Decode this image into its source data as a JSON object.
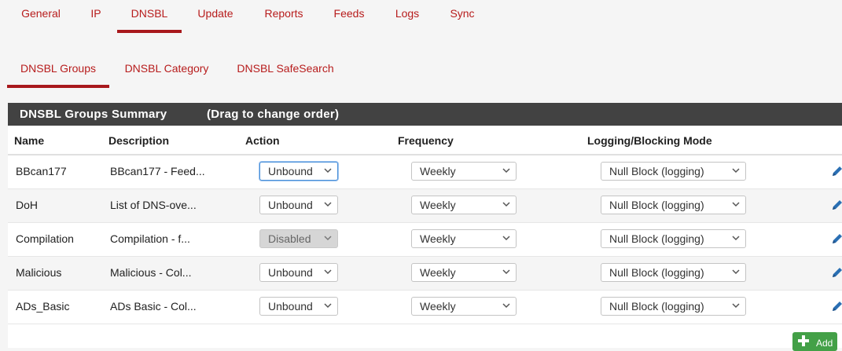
{
  "top_tabs": [
    {
      "label": "General",
      "active": false
    },
    {
      "label": "IP",
      "active": false
    },
    {
      "label": "DNSBL",
      "active": true
    },
    {
      "label": "Update",
      "active": false
    },
    {
      "label": "Reports",
      "active": false
    },
    {
      "label": "Feeds",
      "active": false
    },
    {
      "label": "Logs",
      "active": false
    },
    {
      "label": "Sync",
      "active": false
    }
  ],
  "sub_tabs": [
    {
      "label": "DNSBL Groups",
      "active": true
    },
    {
      "label": "DNSBL Category",
      "active": false
    },
    {
      "label": "DNSBL SafeSearch",
      "active": false
    }
  ],
  "panel": {
    "title": "DNSBL Groups Summary",
    "subtitle": "(Drag to change order)"
  },
  "columns": {
    "name": "Name",
    "description": "Description",
    "action": "Action",
    "frequency": "Frequency",
    "mode": "Logging/Blocking Mode"
  },
  "rows": [
    {
      "name": "BBcan177",
      "description": "BBcan177 - Feed...",
      "action": "Unbound",
      "frequency": "Weekly",
      "mode": "Null Block (logging)"
    },
    {
      "name": "DoH",
      "description": "List of DNS-ove...",
      "action": "Unbound",
      "frequency": "Weekly",
      "mode": "Null Block (logging)"
    },
    {
      "name": "Compilation",
      "description": "Compilation - f...",
      "action": "Disabled",
      "frequency": "Weekly",
      "mode": "Null Block (logging)"
    },
    {
      "name": "Malicious",
      "description": "Malicious - Col...",
      "action": "Unbound",
      "frequency": "Weekly",
      "mode": "Null Block (logging)"
    },
    {
      "name": "ADs_Basic",
      "description": "ADs Basic - Col...",
      "action": "Unbound",
      "frequency": "Weekly",
      "mode": "Null Block (logging)"
    }
  ],
  "add_button": {
    "label": "Add"
  },
  "colors": {
    "accent": "#b71c1c",
    "header_bg": "#424242",
    "add_bg": "#43a047",
    "edit_icon": "#2a6fb3"
  },
  "icons": {
    "edit": "pencil-icon",
    "add": "plus-icon",
    "dropdown": "chevron-down-icon"
  }
}
